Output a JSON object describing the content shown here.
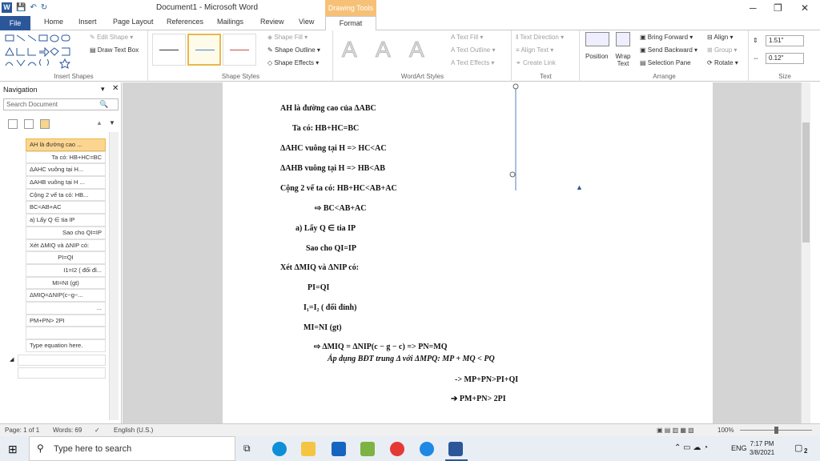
{
  "window": {
    "title": "Document1 - Microsoft Word",
    "context_tab": "Drawing Tools"
  },
  "tabs": {
    "file": "File",
    "home": "Home",
    "insert": "Insert",
    "page_layout": "Page Layout",
    "references": "References",
    "mailings": "Mailings",
    "review": "Review",
    "view": "View",
    "format": "Format"
  },
  "ribbon": {
    "insert_shapes": {
      "label": "Insert Shapes",
      "edit_shape": "Edit Shape",
      "draw_text_box": "Draw Text Box"
    },
    "shape_styles": {
      "label": "Shape Styles",
      "fill": "Shape Fill",
      "outline": "Shape Outline",
      "effects": "Shape Effects"
    },
    "wordart": {
      "label": "WordArt Styles",
      "text_fill": "Text Fill",
      "text_outline": "Text Outline",
      "text_effects": "Text Effects",
      "glyph": "A"
    },
    "text": {
      "label": "Text",
      "direction": "Text Direction",
      "align_text": "Align Text",
      "create_link": "Create Link"
    },
    "arrange": {
      "label": "Arrange",
      "position": "Position",
      "wrap_text": "Wrap Text",
      "bring_forward": "Bring Forward",
      "send_backward": "Send Backward",
      "selection_pane": "Selection Pane",
      "align": "Align",
      "group": "Group",
      "rotate": "Rotate"
    },
    "size": {
      "label": "Size",
      "height": "1.51\"",
      "width": "0.12\""
    }
  },
  "navigation": {
    "title": "Navigation",
    "search_placeholder": "Search Document",
    "items": [
      "AH là đường cao ...",
      "Ta có: HB+HC=BC",
      "ΔAHC vuông tại H...",
      "ΔAHB vuông tại H ...",
      "Cộng 2 vế ta có: HB...",
      "BC<AB+AC",
      "a) Lấy Q ∈ tia IP",
      "Sao cho QI=IP",
      "Xét ΔMIQ và ΔNIP có:",
      "PI=QI",
      "I1=I2 ( đối đỉ...",
      "MI=NI (gt)",
      "ΔMIQ=ΔNIP(c−g−...",
      "...",
      "PM+PN> 2PI",
      "",
      "Type equation here."
    ]
  },
  "document": {
    "lines": [
      "AH là đường cao của ΔABC",
      "Ta có: HB+HC=BC",
      "ΔAHC vuông tại H => HC<AC",
      "ΔAHB vuông tại H => HB<AB",
      "Cộng 2 vế ta có: HB+HC<AB+AC",
      "⇨ BC<AB+AC",
      "a)  Lấy Q ∈ tia IP",
      "Sao cho QI=IP",
      "Xét ΔMIQ và ΔNIP có:",
      "PI=QI",
      "I₁=I₂ ( đối đỉnh)",
      "MI=NI (gt)",
      "⇨  ΔMIQ = ΔNIP(c − g − c) => PN=MQ",
      "Áp dụng BĐT trung Δ với ΔMPQ: MP + MQ < PQ",
      "->   MP+PN>PI+QI",
      "➔  PM+PN> 2PI"
    ]
  },
  "status": {
    "page": "Page: 1 of 1",
    "words": "Words: 69",
    "language": "English (U.S.)",
    "zoom": "100%"
  },
  "taskbar": {
    "search_placeholder": "Type here to search",
    "language": "ENG",
    "time": "7:17 PM",
    "date": "3/8/2021",
    "notifications": "2"
  }
}
